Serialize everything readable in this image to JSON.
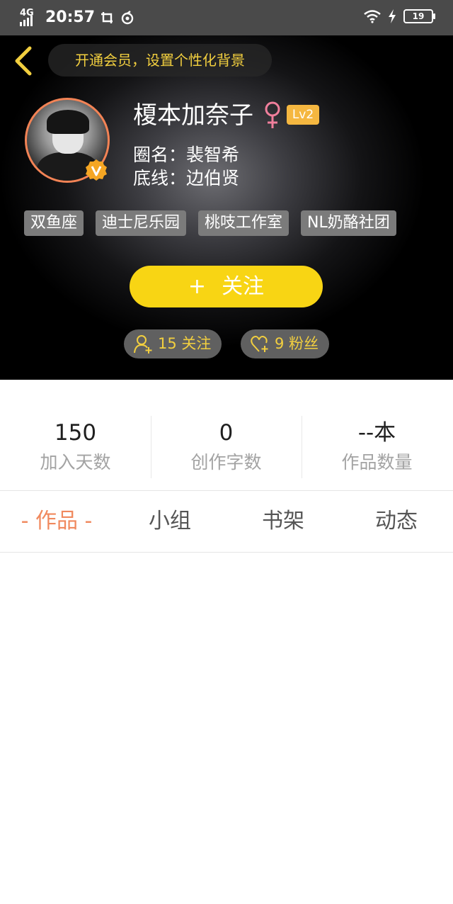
{
  "status_bar": {
    "network": "4G",
    "time": "20:57",
    "battery": "19",
    "icons": [
      "signal-icon",
      "screenshot-icon",
      "sync-icon",
      "wifi-icon",
      "charging-icon",
      "battery-icon"
    ]
  },
  "header": {
    "back_icon": "chevron-left-icon",
    "vip_banner": "开通会员，设置个性化背景"
  },
  "profile": {
    "username": "榎本加奈子",
    "gender_icon": "female-icon",
    "level": "Lv2",
    "verified_badge": "V",
    "circle_name": "圈名：裴智希",
    "bottom_line": "底线：边伯贤",
    "tags": [
      "双鱼座",
      "迪士尼乐园",
      "桃吱工作室",
      "NL奶酪社团"
    ],
    "follow_button": {
      "icon": "+",
      "label": "关注"
    },
    "following": "15 关注",
    "followers": "9 粉丝"
  },
  "stats": [
    {
      "value": "150",
      "label": "加入天数"
    },
    {
      "value": "0",
      "label": "创作字数"
    },
    {
      "value": "--本",
      "label": "作品数量"
    }
  ],
  "tabs": [
    {
      "label": "- 作品 -",
      "active": true
    },
    {
      "label": "小组",
      "active": false
    },
    {
      "label": "书架",
      "active": false
    },
    {
      "label": "动态",
      "active": false
    }
  ],
  "colors": {
    "accent_yellow": "#f8d514",
    "banner_text": "#f2cf3f",
    "level_badge": "#f5b740",
    "active_tab": "#f0895e",
    "gender_pink": "#f07f9c"
  }
}
